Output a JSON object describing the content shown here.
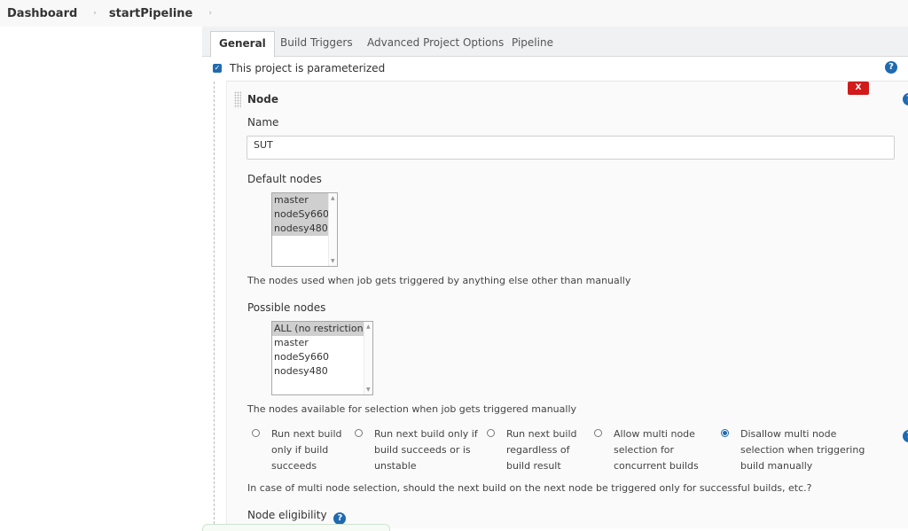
{
  "breadcrumbs": {
    "items": [
      "Dashboard",
      "startPipeline"
    ],
    "separator": "›"
  },
  "tabs": [
    {
      "label": "General",
      "active": true
    },
    {
      "label": "Build Triggers",
      "active": false
    },
    {
      "label": "Advanced Project Options",
      "active": false
    },
    {
      "label": "Pipeline",
      "active": false
    }
  ],
  "parameterized": {
    "label": "This project is parameterized",
    "checked": true
  },
  "help_glyph": "?",
  "parameter": {
    "title": "Node",
    "delete_label": "X",
    "name_label": "Name",
    "name_value": "SUT",
    "default_nodes": {
      "label": "Default nodes",
      "options": [
        "master",
        "nodeSy660",
        "nodesy480"
      ],
      "selected": [
        "master",
        "nodeSy660",
        "nodesy480"
      ],
      "description": "The nodes used when job gets triggered by anything else other than manually"
    },
    "possible_nodes": {
      "label": "Possible nodes",
      "options": [
        "ALL (no restriction)",
        "master",
        "nodeSy660",
        "nodesy480"
      ],
      "selected": [
        "ALL (no restriction)"
      ],
      "description": "The nodes available for selection when job gets triggered manually"
    },
    "trigger_options": [
      {
        "lines": [
          "Run next build",
          "only if build",
          "succeeds"
        ],
        "checked": false
      },
      {
        "lines": [
          "Run next build only if",
          "build succeeds or is",
          "unstable"
        ],
        "checked": false
      },
      {
        "lines": [
          "Run next build",
          "regardless of",
          "build result"
        ],
        "checked": false
      },
      {
        "lines": [
          "Allow multi node",
          "selection for",
          "concurrent builds"
        ],
        "checked": false
      },
      {
        "lines": [
          "Disallow multi node",
          "selection when triggering",
          "build manually"
        ],
        "checked": true
      }
    ],
    "trigger_description": "In case of multi node selection, should the next build on the next node be triggered only for successful builds, etc.?",
    "node_eligibility_label": "Node eligibility"
  },
  "colors": {
    "accent": "#1f6ab0",
    "delete": "#d11a1a"
  }
}
